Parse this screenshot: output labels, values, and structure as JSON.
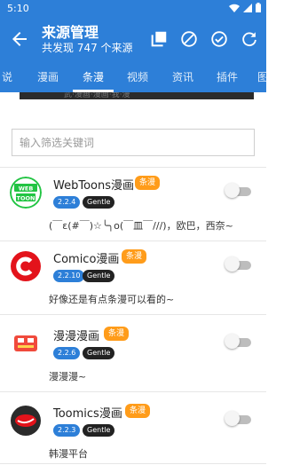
{
  "status_bar": {
    "time": "5:10"
  },
  "header": {
    "title": "来源管理",
    "subtitle": "共发现 747 个来源"
  },
  "tabs": [
    {
      "label": "说",
      "active": false
    },
    {
      "label": "漫画",
      "active": false
    },
    {
      "label": "条漫",
      "active": true
    },
    {
      "label": "视频",
      "active": false
    },
    {
      "label": "资讯",
      "active": false
    },
    {
      "label": "插件",
      "active": false
    },
    {
      "label": "图",
      "active": false
    }
  ],
  "banner": {
    "text": "武·漫画·漫画·我·漫"
  },
  "filter": {
    "placeholder": "输入筛选关键词",
    "value": ""
  },
  "sources": [
    {
      "name": "WebToons漫画",
      "category": "条漫",
      "version": "2.2.4",
      "author": "Gentle",
      "description": "(￣ε(#￣)☆╰╮o(￣皿￣///)，欧巴，西奈~",
      "enabled": false,
      "logo": "webtoon-logo"
    },
    {
      "name": "Comico漫画",
      "category": "条漫",
      "version": "2.2.10",
      "author": "Gentle",
      "description": "好像还是有点条漫可以看的~",
      "enabled": false,
      "logo": "comico-logo"
    },
    {
      "name": "漫漫漫画",
      "category": "条漫",
      "version": "2.2.6",
      "author": "Gentle",
      "description": "漫漫漫~",
      "enabled": false,
      "logo": "manman-logo"
    },
    {
      "name": "Toomics漫画",
      "category": "条漫",
      "version": "2.2.3",
      "author": "Gentle",
      "description": "韩漫平台",
      "enabled": false,
      "logo": "toomics-logo"
    }
  ],
  "colors": {
    "primary": "#2d7fd8",
    "category_badge": "#ff9c1a",
    "author_badge": "#222222"
  }
}
